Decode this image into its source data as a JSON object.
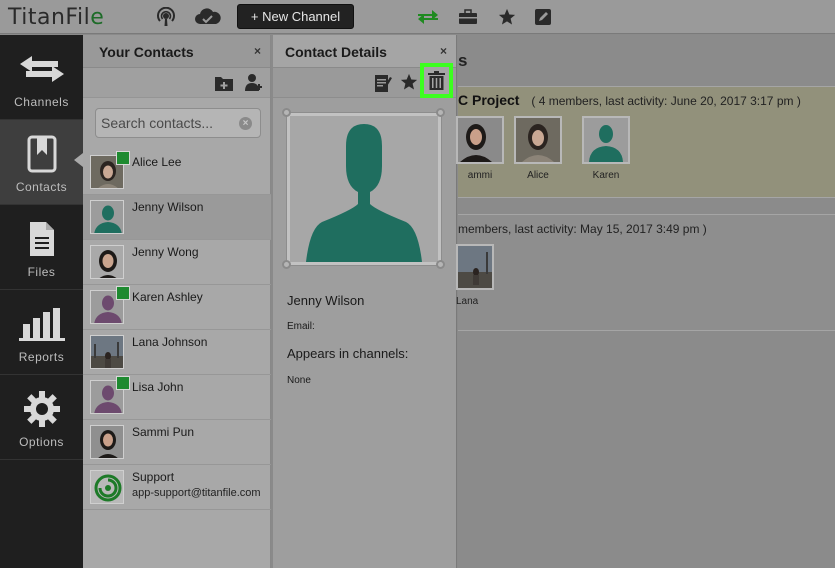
{
  "topbar": {
    "logo_text": "TitanFil",
    "logo_mark": "e",
    "new_channel_label": "+ New Channel",
    "icons": [
      "podcast-icon",
      "cloud-sync-icon",
      "transfer-arrows-icon",
      "briefcase-icon",
      "star-icon",
      "edit-icon"
    ]
  },
  "leftnav": {
    "items": [
      {
        "label": "Channels",
        "icon": "swap-arrows-icon"
      },
      {
        "label": "Contacts",
        "icon": "address-book-icon"
      },
      {
        "label": "Files",
        "icon": "file-icon"
      },
      {
        "label": "Reports",
        "icon": "bar-chart-icon"
      },
      {
        "label": "Options",
        "icon": "gear-icon"
      }
    ],
    "active": "Contacts"
  },
  "contacts_panel": {
    "title": "Your Contacts",
    "close": "×",
    "search": {
      "placeholder": "Search contacts...",
      "value": ""
    },
    "contacts": [
      {
        "name": "Alice Lee",
        "sub": "",
        "badge": true
      },
      {
        "name": "Jenny Wilson",
        "sub": "",
        "badge": false,
        "selected": true
      },
      {
        "name": "Jenny Wong",
        "sub": "",
        "badge": false
      },
      {
        "name": "Karen Ashley",
        "sub": "",
        "badge": true
      },
      {
        "name": "Lana Johnson",
        "sub": "",
        "badge": false
      },
      {
        "name": "Lisa John",
        "sub": "",
        "badge": true
      },
      {
        "name": "Sammi Pun",
        "sub": "",
        "badge": false
      },
      {
        "name": "Support",
        "sub": "app-support@titanfile.com",
        "badge": false
      }
    ]
  },
  "details_panel": {
    "title": "Contact Details",
    "close": "×",
    "name": "Jenny Wilson",
    "email_label": "Email:",
    "appears_label": "Appears in channels:",
    "appears_value": "None"
  },
  "main": {
    "heading_fragment": "s",
    "channel1": {
      "title": "C Project",
      "meta": "( 4 members, last activity: June 20, 2017 3:17 pm )",
      "members": [
        "ammi",
        "Alice",
        "Karen"
      ]
    },
    "channel2": {
      "meta": "members, last activity: May 15, 2017 3:49 pm )",
      "members": [
        "Lana"
      ]
    }
  },
  "colors": {
    "highlight": "#3cff1f",
    "silhouette": "#1f6e5f",
    "badge": "#1e8a30"
  }
}
